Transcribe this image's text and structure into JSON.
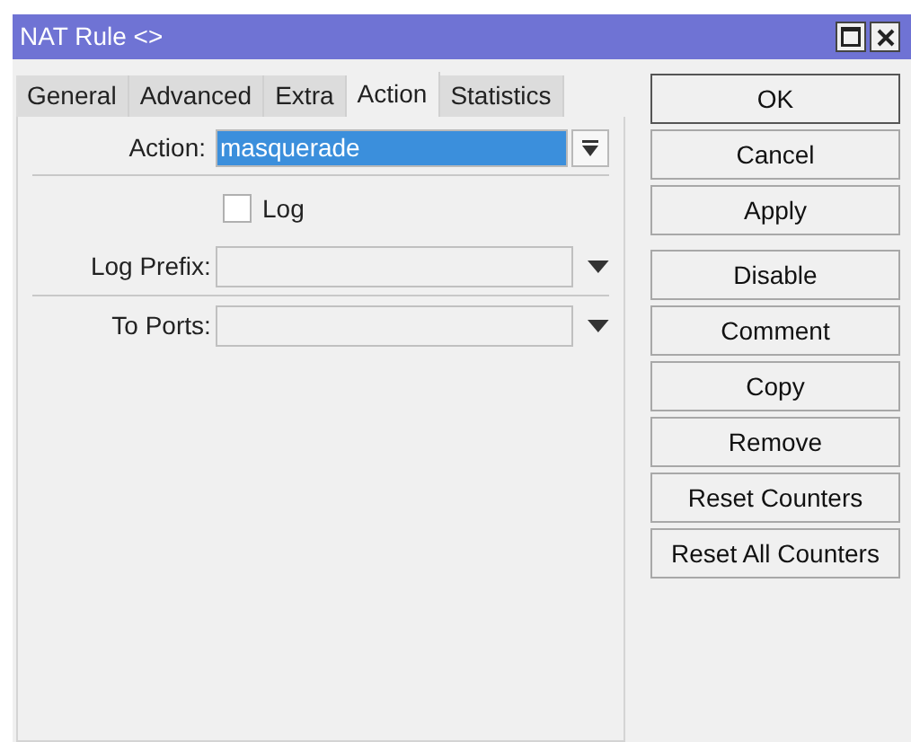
{
  "window": {
    "title": "NAT Rule <>"
  },
  "tabs": [
    {
      "label": "General",
      "selected": false
    },
    {
      "label": "Advanced",
      "selected": false
    },
    {
      "label": "Extra",
      "selected": false
    },
    {
      "label": "Action",
      "selected": true
    },
    {
      "label": "Statistics",
      "selected": false
    }
  ],
  "fields": [
    {
      "kind": "select",
      "label": "Action:",
      "value": "masquerade",
      "highlighted": true
    },
    {
      "kind": "checkbox",
      "label": "Log",
      "checked": false
    },
    {
      "kind": "combo",
      "label": "Log Prefix:"
    },
    {
      "kind": "combo",
      "label": "To Ports:"
    }
  ],
  "button_groups": [
    [
      "OK",
      "Cancel",
      "Apply"
    ],
    [
      "Disable",
      "Comment",
      "Copy",
      "Remove",
      "Reset Counters",
      "Reset All Counters"
    ]
  ]
}
